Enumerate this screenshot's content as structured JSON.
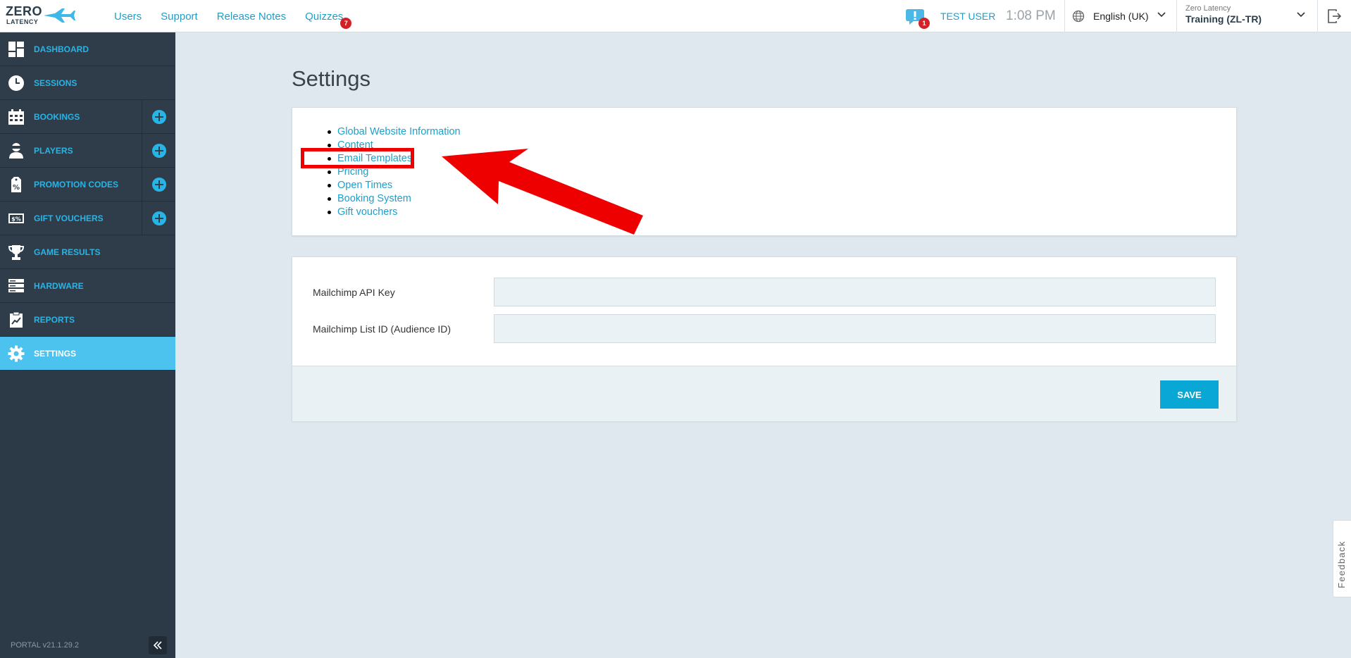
{
  "logo": {
    "line1": "ZERO",
    "line2": "LATENCY"
  },
  "topnav": {
    "items": [
      "Users",
      "Support",
      "Release Notes",
      "Quizzes"
    ],
    "quizzes_badge": "7"
  },
  "notifications": {
    "count": "1"
  },
  "user": {
    "name": "TEST USER"
  },
  "clock": {
    "time": "1:08 PM"
  },
  "language": {
    "selected": "English (UK)"
  },
  "site": {
    "company": "Zero Latency",
    "selected": "Training (ZL-TR)"
  },
  "sidebar": {
    "items": [
      {
        "label": "DASHBOARD",
        "icon": "dashboard-icon"
      },
      {
        "label": "SESSIONS",
        "icon": "clock-icon"
      },
      {
        "label": "BOOKINGS",
        "icon": "calendar-icon",
        "add": true
      },
      {
        "label": "PLAYERS",
        "icon": "player-icon",
        "add": true
      },
      {
        "label": "PROMOTION CODES",
        "icon": "percent-tag-icon",
        "add": true
      },
      {
        "label": "GIFT VOUCHERS",
        "icon": "voucher-icon",
        "add": true
      },
      {
        "label": "GAME RESULTS",
        "icon": "trophy-icon"
      },
      {
        "label": "HARDWARE",
        "icon": "server-icon"
      },
      {
        "label": "REPORTS",
        "icon": "report-icon"
      },
      {
        "label": "SETTINGS",
        "icon": "gear-icon",
        "active": true
      }
    ],
    "version": "PORTAL v21.1.29.2"
  },
  "main": {
    "title": "Settings",
    "links": [
      "Global Website Information",
      "Content",
      "Email Templates",
      "Pricing",
      "Open Times",
      "Booking System",
      "Gift vouchers"
    ],
    "form": {
      "mailchimp_api_label": "Mailchimp API Key",
      "mailchimp_api_value": "",
      "mailchimp_list_label": "Mailchimp List ID (Audience ID)",
      "mailchimp_list_value": "",
      "save_label": "SAVE"
    }
  },
  "feedback": {
    "label": "Feedback"
  },
  "colors": {
    "accent": "#1e9fc8",
    "sidebar_bg": "#2c3a47",
    "active_nav": "#4cc2ee",
    "save_button": "#08a7d6",
    "highlight": "#ef0000"
  }
}
